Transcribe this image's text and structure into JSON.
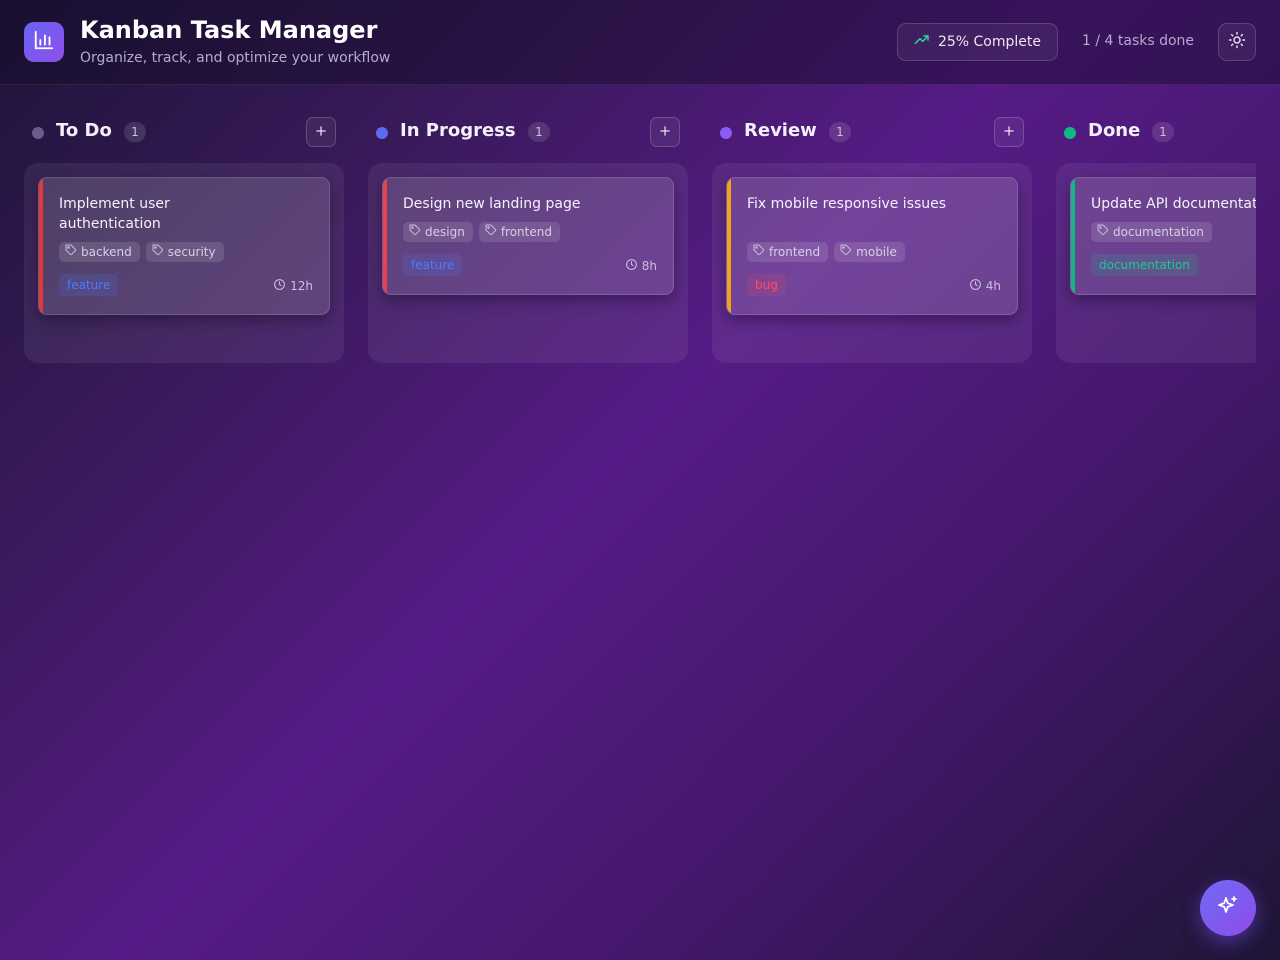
{
  "header": {
    "title": "Kanban Task Manager",
    "subtitle": "Organize, track, and optimize your workflow",
    "progress_label": "25% Complete",
    "tasks_done": "1 / 4 tasks done",
    "logo_icon": "bar-chart-icon",
    "progress_icon": "trending-up-icon",
    "theme_icon": "sun-icon"
  },
  "columns": [
    {
      "title": "To Do",
      "count": "1",
      "dot_color": "#6b5b8e",
      "cards": [
        {
          "title": "Implement user authentication",
          "tags": [
            "backend",
            "security"
          ],
          "type": "feature",
          "estimate": "12h",
          "accent": "#e03a3a"
        }
      ]
    },
    {
      "title": "In Progress",
      "count": "1",
      "dot_color": "#5b6cf0",
      "cards": [
        {
          "title": "Design new landing page",
          "tags": [
            "design",
            "frontend"
          ],
          "type": "feature",
          "estimate": "8h",
          "accent": "#e8434c"
        }
      ]
    },
    {
      "title": "Review",
      "count": "1",
      "dot_color": "#8a5cf6",
      "cards": [
        {
          "title": "Fix mobile responsive issues",
          "tags": [
            "frontend",
            "mobile"
          ],
          "type": "bug",
          "estimate": "4h",
          "accent": "#f0a41c"
        }
      ]
    },
    {
      "title": "Done",
      "count": "1",
      "dot_color": "#10b981",
      "cards": [
        {
          "title": "Update API documentation",
          "tags": [
            "documentation"
          ],
          "type": "documentation",
          "estimate": "",
          "accent": "#10b981"
        }
      ]
    }
  ],
  "colors": {
    "feature": "#4f7bff",
    "bug": "#ff4d5e",
    "documentation": "#1ec88f"
  },
  "fab": {
    "icon": "sparkles-icon"
  }
}
